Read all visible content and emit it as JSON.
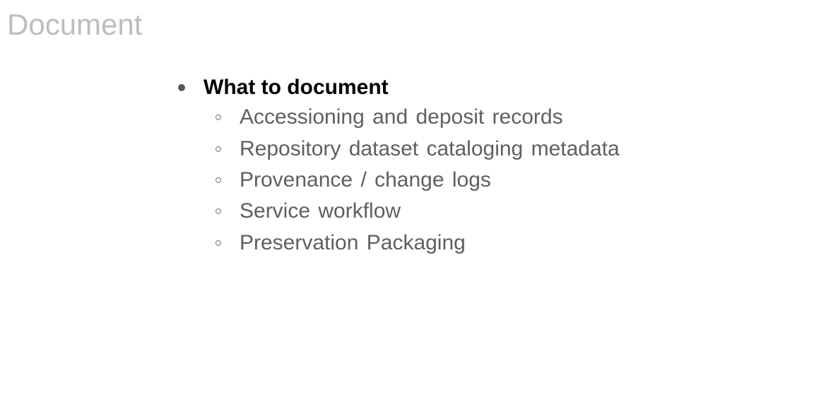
{
  "slide": {
    "title": "Document"
  },
  "main_item": {
    "label": "What to document",
    "sub_items": [
      {
        "label": "Accessioning and deposit records"
      },
      {
        "label": "Repository dataset cataloging metadata"
      },
      {
        "label": "Provenance / change logs"
      },
      {
        "label": "Service workflow"
      },
      {
        "label": "Preservation Packaging"
      }
    ]
  },
  "colors": {
    "title": "#bdbdbd",
    "main_text": "#000000",
    "sub_text": "#5f5f5f"
  }
}
